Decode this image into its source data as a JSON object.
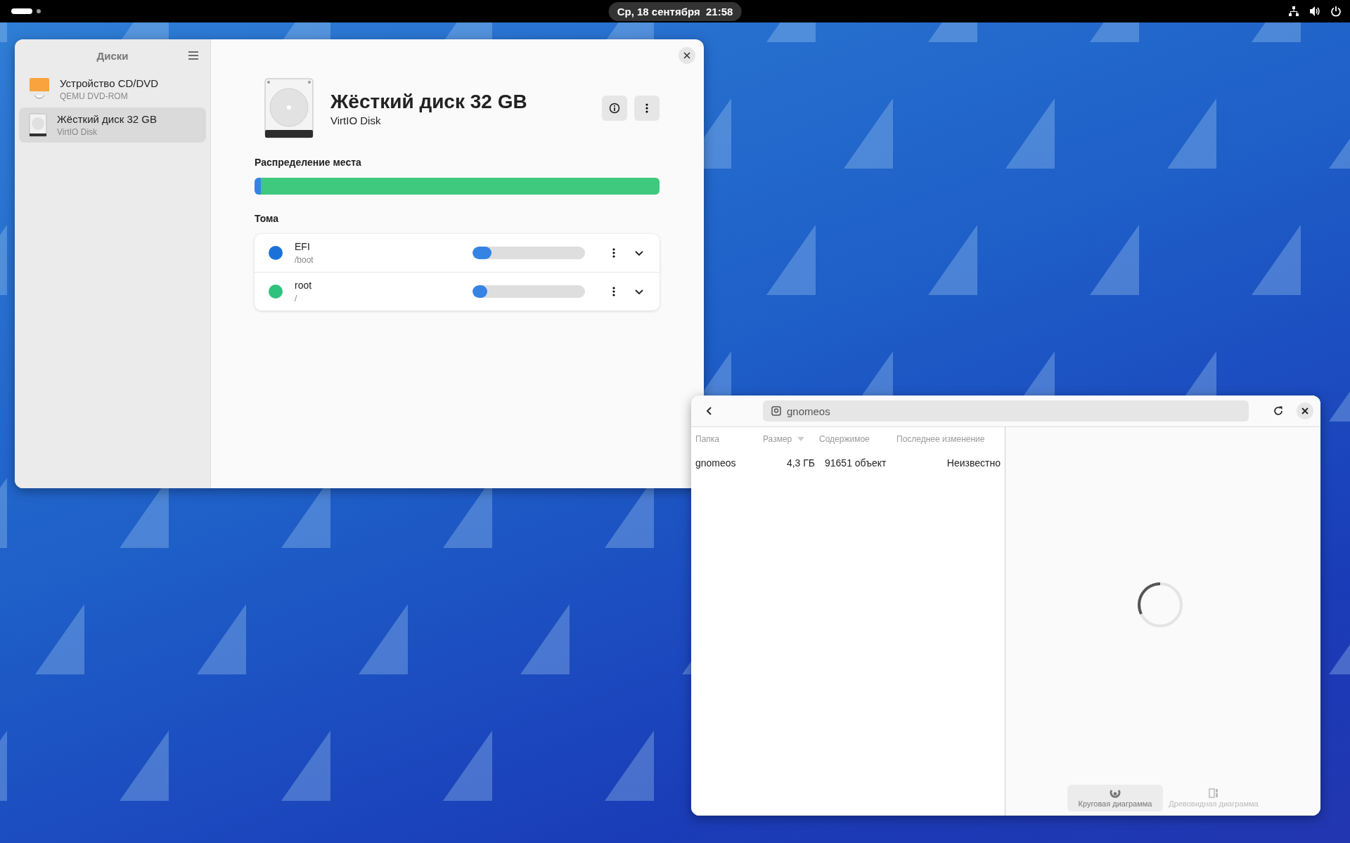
{
  "top_bar": {
    "clock": "Ср, 18 сентября  21:58"
  },
  "disks_window": {
    "sidebar": {
      "title": "Диски",
      "items": [
        {
          "kind": "optical",
          "name": "Устройство CD/DVD",
          "model": "QEMU DVD-ROM",
          "selected": false
        },
        {
          "kind": "hdd",
          "name": "Жёсткий диск 32 GB",
          "model": "VirtIO Disk",
          "selected": true
        }
      ]
    },
    "disk": {
      "title": "Жёсткий диск 32 GB",
      "subtitle": "VirtIO Disk"
    },
    "allocation": {
      "heading": "Распределение места",
      "segments": [
        {
          "color": "#3584e4",
          "level": 0.016
        },
        {
          "color": "#3ec97e",
          "level": 0.984
        }
      ]
    },
    "volumes": {
      "heading": "Тома",
      "items": [
        {
          "name": "EFI",
          "mount": "/boot",
          "color": "#1c71d8",
          "level": 0.17
        },
        {
          "name": "root",
          "mount": "/",
          "color": "#2ec27e",
          "level": 0.13
        }
      ]
    }
  },
  "analyzer_window": {
    "path": "gnomeos",
    "columns": [
      {
        "label": "Папка",
        "sorted": false
      },
      {
        "label": "Размер",
        "sorted": true
      },
      {
        "label": "Содержимое",
        "sorted": false
      },
      {
        "label": "Последнее изменение",
        "sorted": false
      }
    ],
    "rows": [
      {
        "folder": "gnomeos",
        "size": "4,3 ГБ",
        "contents": "91651 объект",
        "modified": "Неизвестно"
      }
    ],
    "views": [
      {
        "label": "Круговая диаграмма",
        "kind": "ring",
        "selected": true
      },
      {
        "label": "Древовидная диаграмма",
        "kind": "tree",
        "selected": false
      }
    ]
  }
}
